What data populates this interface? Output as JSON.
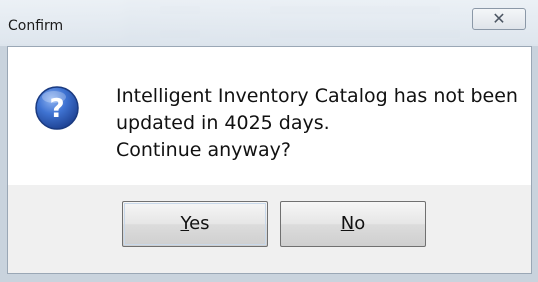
{
  "window": {
    "title": "Confirm",
    "close_symbol": "✕"
  },
  "dialog": {
    "message_lines": [
      "Intelligent Inventory Catalog has not been",
      "updated in 4025 days.",
      "Continue anyway?"
    ],
    "icon": "question-icon",
    "buttons": {
      "yes": {
        "mnemonic": "Y",
        "rest": "es"
      },
      "no": {
        "mnemonic": "N",
        "rest": "o"
      }
    }
  },
  "colors": {
    "icon_blue": "#2b5fc4",
    "client_bg": "#ffffff",
    "footer_bg": "#f0f0f0"
  }
}
